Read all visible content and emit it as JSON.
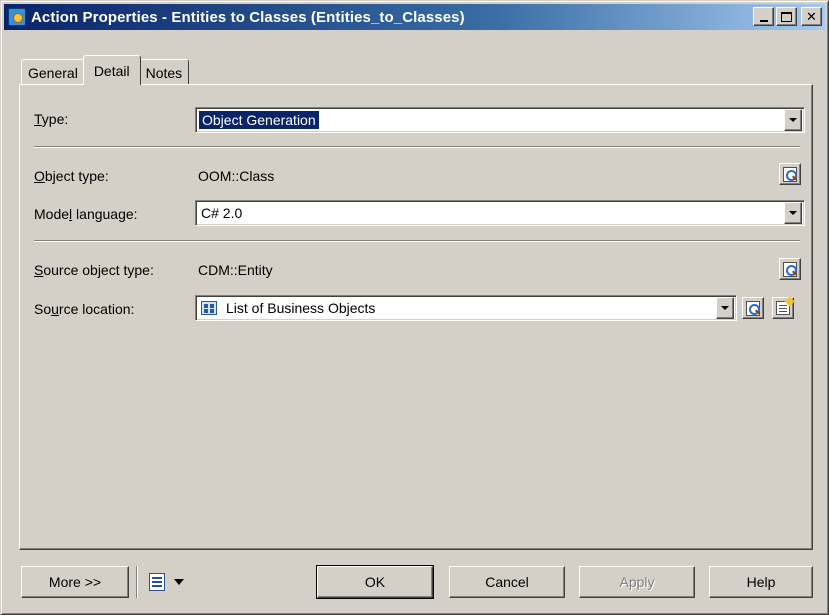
{
  "window": {
    "title": "Action Properties - Entities to Classes (Entities_to_Classes)",
    "title_icon": "action-icon",
    "controls": [
      "minimize",
      "maximize",
      "close"
    ]
  },
  "tabs": [
    {
      "label": "General",
      "active": false
    },
    {
      "label": "Detail",
      "active": true
    },
    {
      "label": "Notes",
      "active": false
    }
  ],
  "detail": {
    "type": {
      "label": "Type:",
      "value": "Object Generation"
    },
    "object_type": {
      "label": "Object type:",
      "value": "OOM::Class"
    },
    "model_language": {
      "label": "Model language:",
      "value": "C# 2.0"
    },
    "source_object_type": {
      "label": "Source object type:",
      "value": "CDM::Entity"
    },
    "source_location": {
      "label": "Source location:",
      "value": "List of Business Objects",
      "icon": "business-objects-list-icon"
    }
  },
  "buttons": {
    "more": "More >>",
    "ok": "OK",
    "cancel": "Cancel",
    "apply": "Apply",
    "help": "Help"
  },
  "colors": {
    "face": "#d4d0c8",
    "title_start": "#0a246a",
    "title_end": "#a6caf0",
    "selection": "#0a246a"
  }
}
